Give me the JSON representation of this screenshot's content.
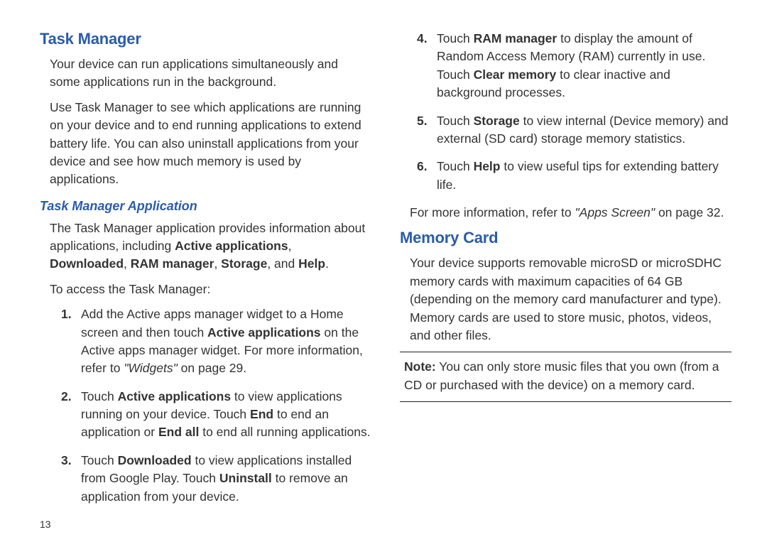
{
  "left": {
    "h1": "Task Manager",
    "p1": "Your device can run applications simultaneously and some applications run in the background.",
    "p2": "Use Task Manager to see which applications are running on your device and to end running applications to extend battery life. You can also uninstall applications from your device and see how much memory is used by applications.",
    "h2": "Task Manager Application",
    "p3a": "The Task Manager application provides information about applications, including ",
    "p3b_active": "Active applications",
    "p3c": ", ",
    "p3d_down": "Downloaded",
    "p3e": ", ",
    "p3f_ram": "RAM manager",
    "p3g": ", ",
    "p3h_storage": "Storage",
    "p3i": ", and ",
    "p3j_help": "Help",
    "p3k": ".",
    "p4": "To access the Task Manager:",
    "li1_num": "1.",
    "li1_a": "Add the Active apps manager widget to a Home screen and then touch ",
    "li1_b": "Active applications",
    "li1_c": " on the Active apps manager widget. For more information, refer to ",
    "li1_d": "\"Widgets\"",
    "li1_e": " on page 29.",
    "li2_num": "2.",
    "li2_a": "Touch ",
    "li2_b": "Active applications",
    "li2_c": " to view applications running on your device. Touch ",
    "li2_d": "End",
    "li2_e": " to end an application or ",
    "li2_f": "End all",
    "li2_g": " to end all running applications.",
    "li3_num": "3.",
    "li3_a": "Touch ",
    "li3_b": "Downloaded",
    "li3_c": " to view applications installed from Google Play. Touch ",
    "li3_d": "Uninstall",
    "li3_e": " to remove an application from your device.",
    "pagenum": "13"
  },
  "right": {
    "li4_num": "4.",
    "li4_a": "Touch ",
    "li4_b": "RAM manager",
    "li4_c": " to display the amount of Random Access Memory (RAM) currently in use. Touch ",
    "li4_d": "Clear memory",
    "li4_e": " to clear inactive and background processes.",
    "li5_num": "5.",
    "li5_a": "Touch ",
    "li5_b": "Storage",
    "li5_c": " to view internal (Device memory) and external (SD card) storage memory statistics.",
    "li6_num": "6.",
    "li6_a": "Touch ",
    "li6_b": "Help",
    "li6_c": " to view useful tips for extending battery life.",
    "p_more_a": "For more information, refer to ",
    "p_more_b": "\"Apps Screen\"",
    "p_more_c": " on page 32.",
    "h1": "Memory Card",
    "p1": "Your device supports removable microSD or microSDHC memory cards with maximum capacities of 64 GB (depending on the memory card manufacturer and type). Memory cards are used to store music, photos, videos, and other files.",
    "note_a": "Note:",
    "note_b": " You can only store music files that you own (from a CD or purchased with the device) on a memory card."
  }
}
